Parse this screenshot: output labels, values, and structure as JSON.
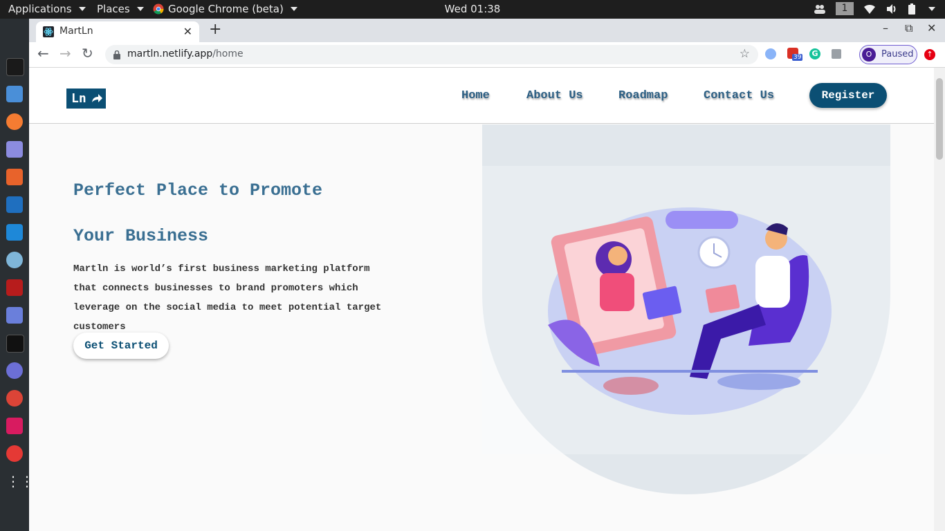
{
  "desktop": {
    "applications_menu": "Applications",
    "places_menu": "Places",
    "active_app": "Google Chrome (beta)",
    "clock": "Wed 01:38",
    "workspace": "1"
  },
  "browser": {
    "tab_title": "MartLn",
    "url_host": "martln.netlify.app",
    "url_path": "/home",
    "extension_badge": "39",
    "profile_initial": "O",
    "profile_status": "Paused"
  },
  "site": {
    "logo": "Ln",
    "nav": [
      "Home",
      "About Us",
      "Roadmap",
      "Contact Us"
    ],
    "register_label": "Register",
    "hero_title_line1": "Perfect Place to Promote",
    "hero_title_line2": "Your Business",
    "hero_description": "Martln is world’s first business marketing platform that connects businesses to brand promoters which leverage on the social media to meet potential target customers",
    "cta_label": "Get Started"
  },
  "colors": {
    "brand": "#0b4f74",
    "heading": "#3a6f92",
    "blob": "#e1e7ec"
  }
}
